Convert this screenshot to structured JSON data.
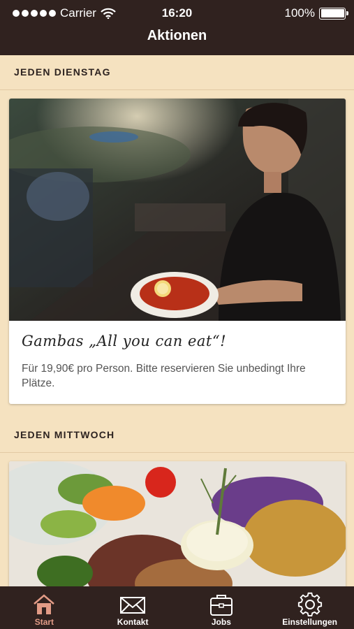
{
  "status_bar": {
    "carrier": "Carrier",
    "time": "16:20",
    "battery": "100%"
  },
  "nav": {
    "title": "Aktionen"
  },
  "sections": [
    {
      "header": "JEDEN DIENSTAG",
      "card": {
        "title": "Gambas „All you can eat“!",
        "text": "Für 19,90€ pro Person. Bitte reservieren Sie unbedingt Ihre Plätze."
      }
    },
    {
      "header": "JEDEN MITTWOCH"
    }
  ],
  "tabbar": {
    "items": [
      {
        "label": "Start",
        "icon": "house-icon",
        "active": true
      },
      {
        "label": "Kontakt",
        "icon": "envelope-icon",
        "active": false
      },
      {
        "label": "Jobs",
        "icon": "briefcase-icon",
        "active": false
      },
      {
        "label": "Einstellungen",
        "icon": "gear-icon",
        "active": false
      }
    ]
  },
  "colors": {
    "bar_background": "#30221f",
    "page_background": "#f5e2c0",
    "active_tab": "#e29b86"
  }
}
